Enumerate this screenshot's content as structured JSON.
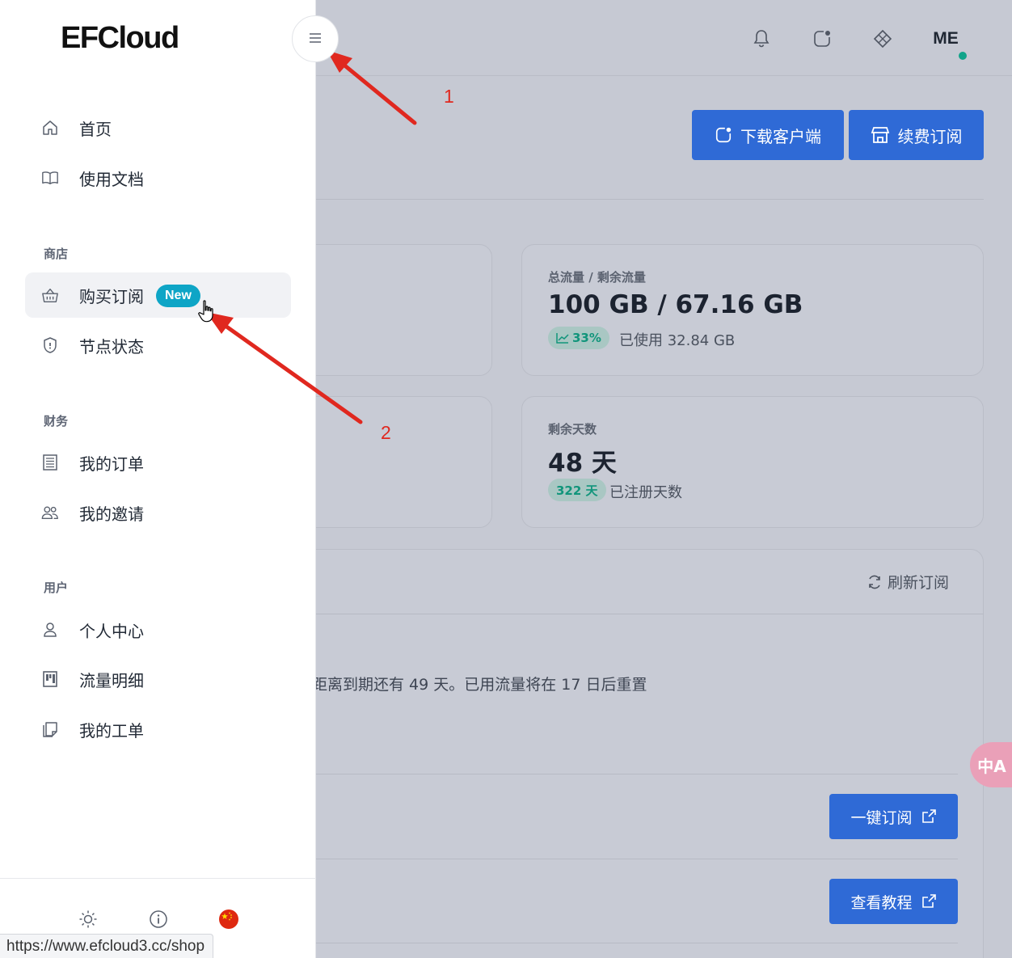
{
  "header": {
    "avatar_text": "ME",
    "icons": [
      "bell-icon",
      "app-download-icon",
      "diamond-icon"
    ]
  },
  "actions": {
    "download_client": "下载客户端",
    "renew_subscription": "续费订阅"
  },
  "cards": {
    "traffic": {
      "label": "总流量 / 剩余流量",
      "value": "100 GB / 67.16 GB",
      "pill": "33%",
      "sub": "已使用 32.84 GB"
    },
    "days": {
      "label": "剩余天数",
      "value": "48 天",
      "pill": "322 天",
      "sub": "已注册天数"
    }
  },
  "subscription": {
    "refresh_label": "刷新订阅",
    "info_text": "距离到期还有 49 天。已用流量将在 17 日后重置",
    "one_click_label": "一键订阅",
    "tutorial_label": "查看教程"
  },
  "translate_fab_label": "中A",
  "sidebar": {
    "logo": "EFCloud",
    "items_top": [
      {
        "label": "首页",
        "icon": "home-icon"
      },
      {
        "label": "使用文档",
        "icon": "book-icon"
      }
    ],
    "sections": [
      {
        "title": "商店",
        "items": [
          {
            "label": "购买订阅",
            "icon": "basket-icon",
            "badge": "New",
            "active": true
          },
          {
            "label": "节点状态",
            "icon": "shield-icon"
          }
        ]
      },
      {
        "title": "财务",
        "items": [
          {
            "label": "我的订单",
            "icon": "receipt-icon"
          },
          {
            "label": "我的邀请",
            "icon": "users-icon"
          }
        ]
      },
      {
        "title": "用户",
        "items": [
          {
            "label": "个人中心",
            "icon": "user-icon"
          },
          {
            "label": "流量明细",
            "icon": "chart-icon"
          },
          {
            "label": "我的工单",
            "icon": "ticket-icon"
          }
        ]
      }
    ],
    "footer_icons": [
      "sun-icon",
      "info-icon",
      "china-flag-icon"
    ]
  },
  "annotations": {
    "arrow_1_label": "1",
    "arrow_2_label": "2",
    "accent_color": "#e0281f"
  },
  "status_bar_url": "https://www.efcloud3.cc/shop"
}
